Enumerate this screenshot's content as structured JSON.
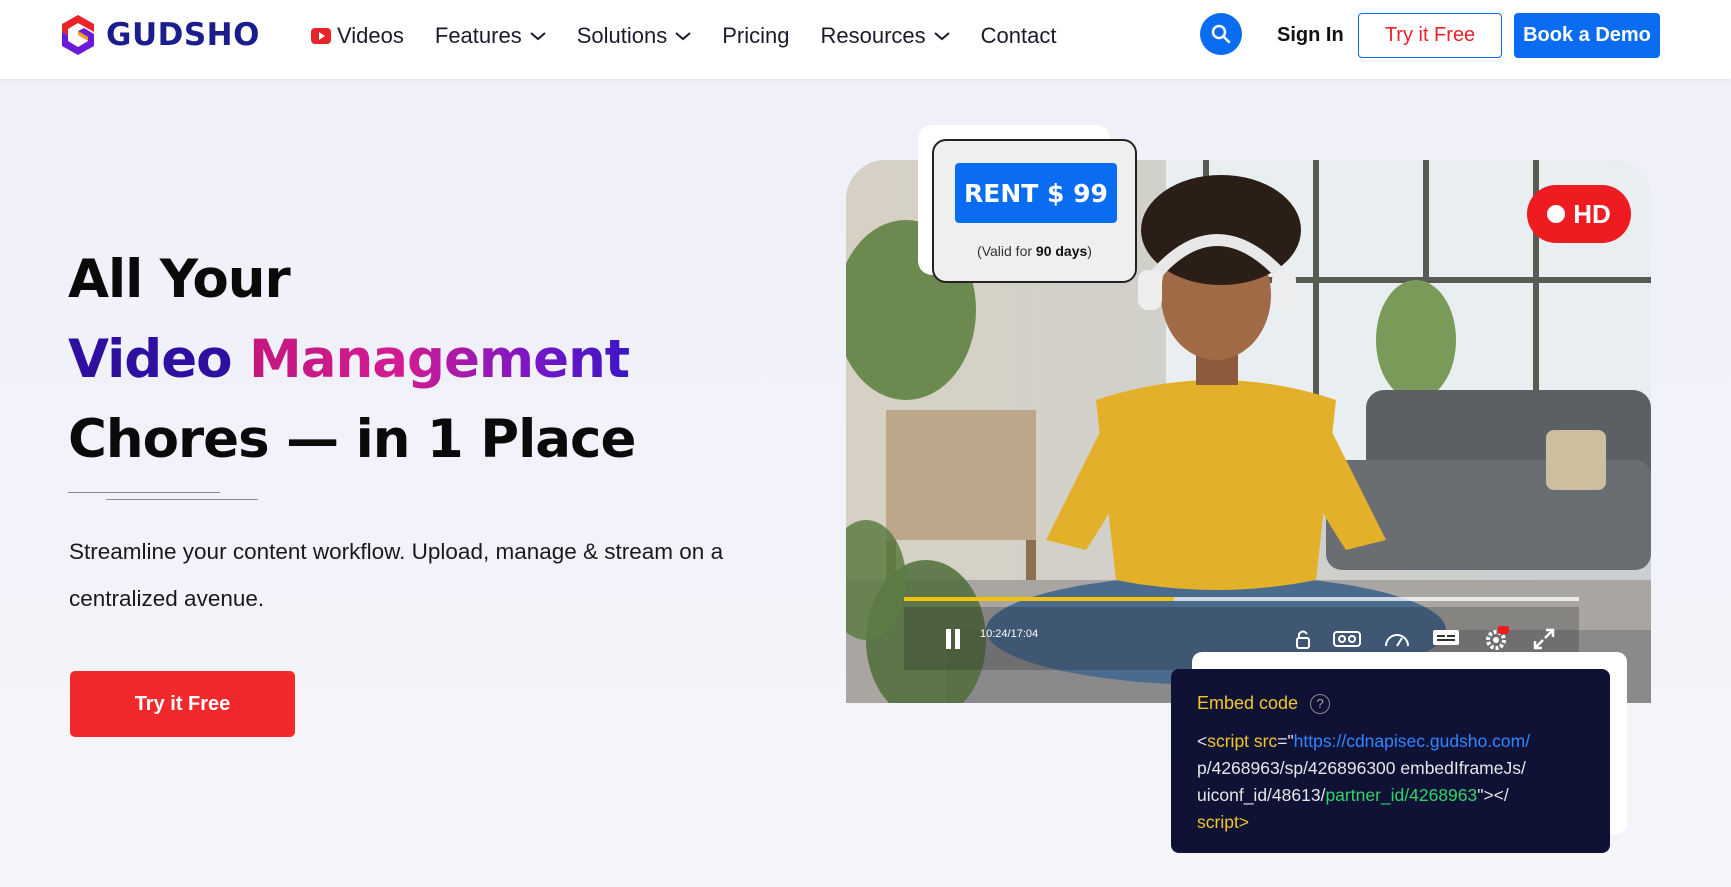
{
  "brand": {
    "name": "GUDSHO"
  },
  "nav": {
    "items": [
      {
        "label": "Videos",
        "has_dropdown": false,
        "icon": "youtube-icon"
      },
      {
        "label": "Features",
        "has_dropdown": true
      },
      {
        "label": "Solutions",
        "has_dropdown": true
      },
      {
        "label": "Pricing",
        "has_dropdown": false
      },
      {
        "label": "Resources",
        "has_dropdown": true
      },
      {
        "label": "Contact",
        "has_dropdown": false
      }
    ],
    "sign_in": "Sign In",
    "try_free": "Try it Free",
    "book_demo": "Book a Demo"
  },
  "hero": {
    "title_line1": "All Your",
    "title_line2_part1": "Video",
    "title_line2_part2": "Management",
    "title_line3": "Chores — in 1 Place",
    "subtitle": "Streamline your content workflow. Upload, manage & stream on a centralized avenue.",
    "cta": "Try it Free"
  },
  "rent_card": {
    "button": "RENT $ 99",
    "valid_prefix": "(Valid for ",
    "valid_days": "90 days",
    "valid_suffix": ")"
  },
  "player": {
    "badge": "HD",
    "time": "10:24/17:04",
    "progress": 0.4
  },
  "embed": {
    "title": "Embed code",
    "code_open": "<",
    "code_script": "script src",
    "code_eq": "=\"",
    "code_url": "https://cdnapisec.gudsho.com/",
    "code_line2": "p/4268963/sp/426896300 embedIframeJs/",
    "code_line3a": "uiconf_id/48613/",
    "code_line3b": "partner_id/4268963",
    "code_line3c": "\"></",
    "code_line4": "script>"
  },
  "colors": {
    "primary_blue": "#0a6cf1",
    "cta_red": "#f1282c",
    "brand_navy": "#1b1d8c",
    "embed_bg": "#0f1235"
  }
}
